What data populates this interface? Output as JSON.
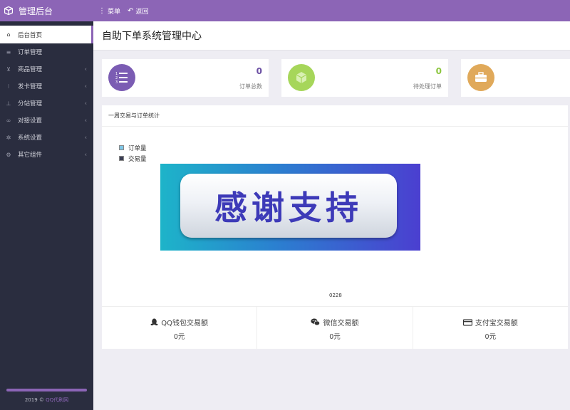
{
  "brand": {
    "title": "管理后台"
  },
  "topmenu": {
    "menu_label": "菜单",
    "back_label": "返回"
  },
  "sidebar": {
    "items": [
      {
        "label": "后台首页",
        "active": true,
        "icon": "home-icon",
        "has_children": false
      },
      {
        "label": "订单管理",
        "active": false,
        "icon": "list-icon",
        "has_children": false
      },
      {
        "label": "商品管理",
        "active": false,
        "icon": "cart-icon",
        "has_children": true
      },
      {
        "label": "发卡管理",
        "active": false,
        "icon": "grid-icon",
        "has_children": true
      },
      {
        "label": "分站管理",
        "active": false,
        "icon": "sitemap-icon",
        "has_children": true
      },
      {
        "label": "对接设置",
        "active": false,
        "icon": "link-icon",
        "has_children": true
      },
      {
        "label": "系统设置",
        "active": false,
        "icon": "gear-icon",
        "has_children": true
      },
      {
        "label": "其它组件",
        "active": false,
        "icon": "cogs-icon",
        "has_children": true
      }
    ],
    "footer_year": "2019 © ",
    "footer_link": "QQ代刷网"
  },
  "page": {
    "title": "自助下单系统管理中心"
  },
  "stats": [
    {
      "value": "0",
      "label": "订单总数",
      "color": "#7b5cb3",
      "icon": "list-ordered-icon"
    },
    {
      "value": "0",
      "label": "待处理订单",
      "color": "#a6d65a",
      "icon": "cube-icon"
    },
    {
      "value": "",
      "label": "",
      "color": "#e0a95a",
      "icon": "briefcase-icon"
    }
  ],
  "panel": {
    "title": "一周交易与订单统计",
    "banner_text": "感谢支持"
  },
  "chart_data": {
    "type": "line",
    "x": [
      "0228"
    ],
    "series": [
      {
        "name": "订单量",
        "color": "#7fc6e6"
      },
      {
        "name": "交易量",
        "color": "#3b3f55"
      }
    ]
  },
  "summary": [
    {
      "label": "QQ钱包交易额",
      "value": "0元",
      "icon": "qq-icon"
    },
    {
      "label": "微信交易额",
      "value": "0元",
      "icon": "wechat-icon"
    },
    {
      "label": "支付宝交易额",
      "value": "0元",
      "icon": "credit-card-icon"
    }
  ]
}
